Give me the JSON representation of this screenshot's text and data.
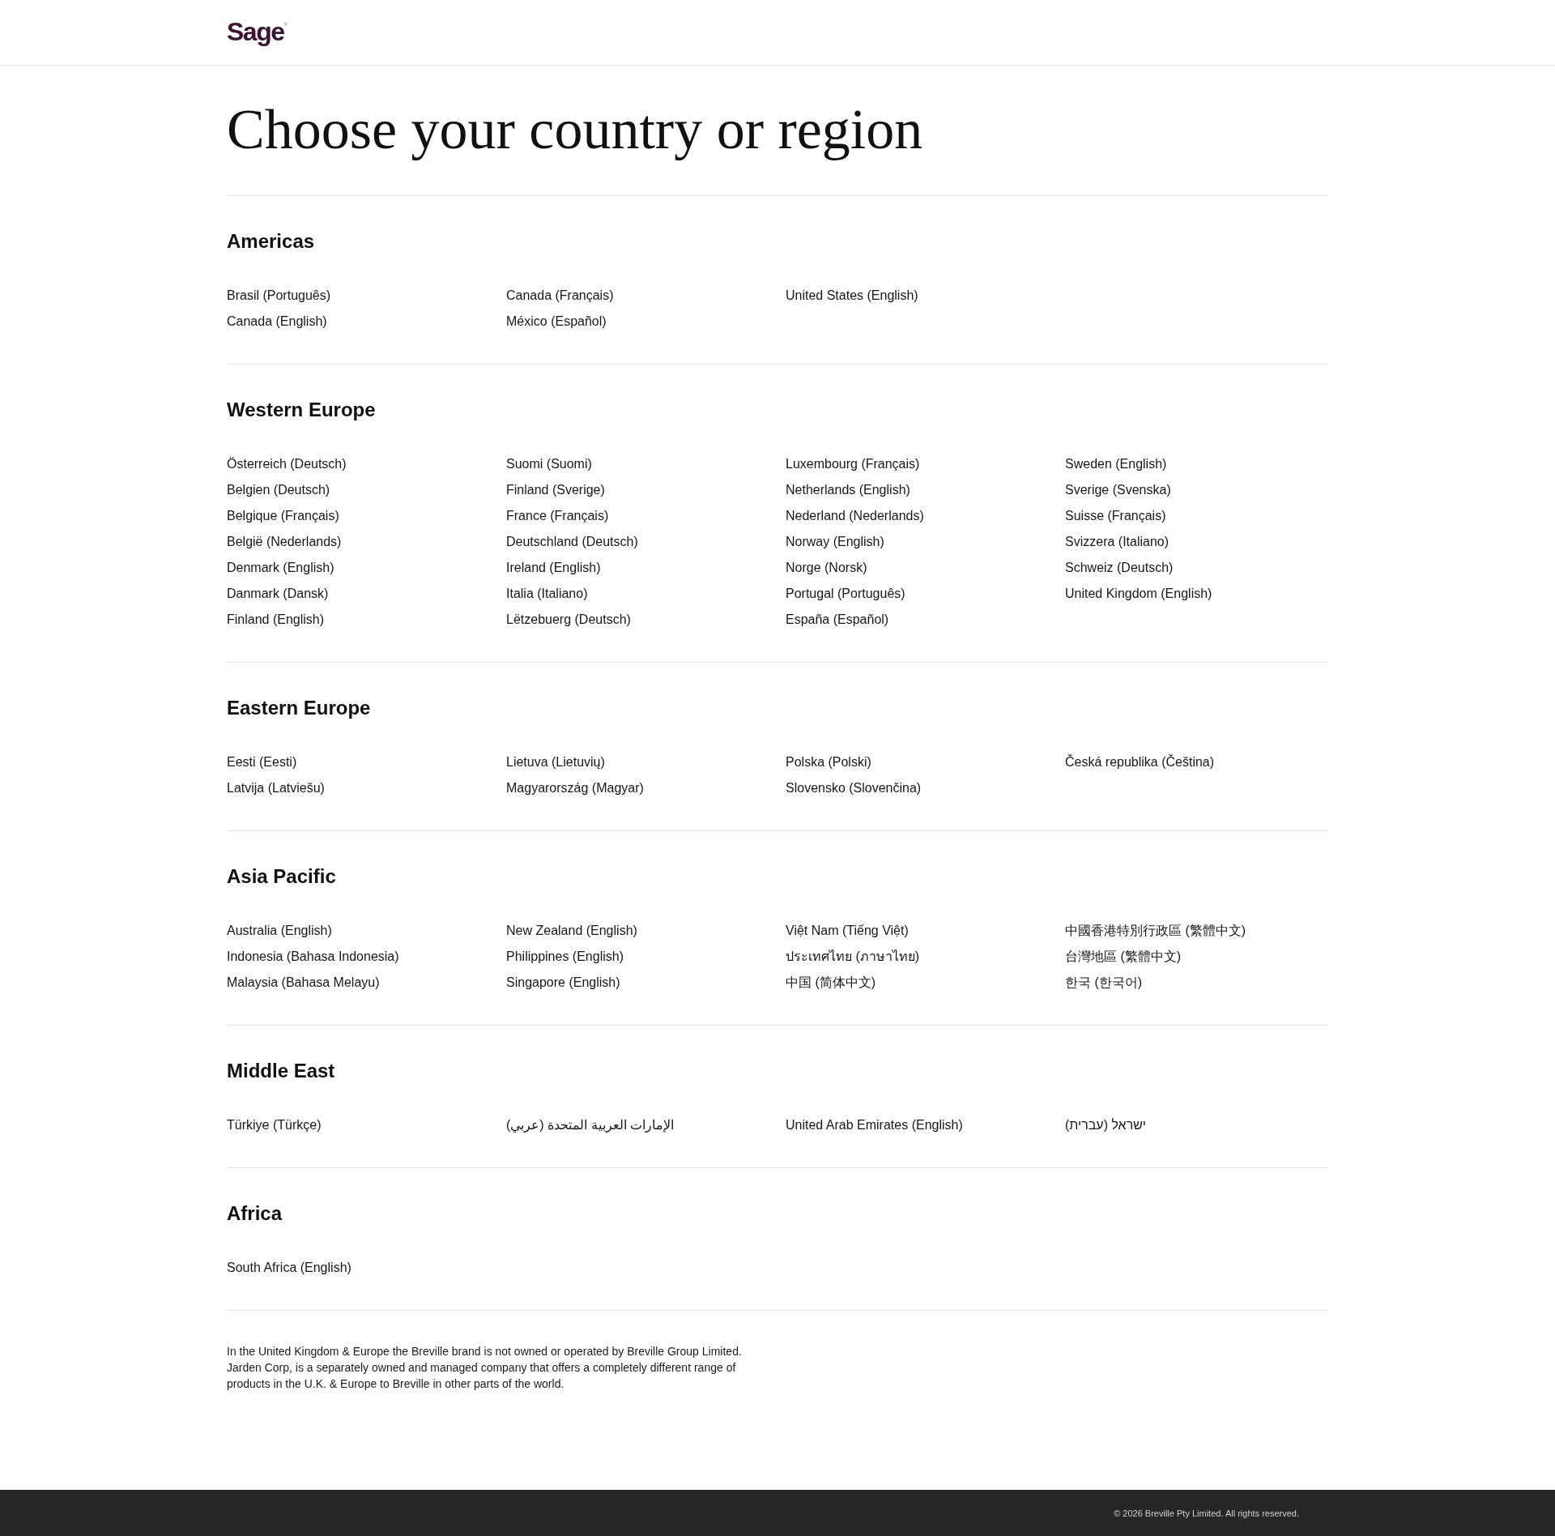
{
  "header": {
    "logo": "Sage$^{®}$"
  },
  "title": "Choose your country or region",
  "regions": [
    {
      "name": "Americas",
      "countries": [
        "Brasil (Português)",
        "Canada (English)",
        "Canada (Français)",
        "México (Español)",
        "United States (English)"
      ]
    },
    {
      "name": "Western Europe",
      "countries": [
        "Österreich (Deutsch)",
        "Belgien (Deutsch)",
        "Belgique (Français)",
        "België (Nederlands)",
        "Denmark (English)",
        "Danmark (Dansk)",
        "Finland (English)",
        "Suomi (Suomi)",
        "Finland (Sverige)",
        "France (Français)",
        "Deutschland (Deutsch)",
        "Ireland (English)",
        "Italia (Italiano)",
        "Lëtzebuerg (Deutsch)",
        "Luxembourg (Français)",
        "Netherlands (English)",
        "Nederland (Nederlands)",
        "Norway (English)",
        "Norge (Norsk)",
        "Portugal (Português)",
        "España (Español)",
        "Sweden (English)",
        "Sverige (Svenska)",
        "Suisse (Français)",
        "Svizzera (Italiano)",
        "Schweiz (Deutsch)",
        "United Kingdom (English)"
      ]
    },
    {
      "name": "Eastern Europe",
      "countries": [
        "Eesti (Eesti)",
        "Latvija (Latviešu)",
        "Lietuva (Lietuvių)",
        "Magyarország (Magyar)",
        "Polska (Polski)",
        "Slovensko (Slovenčina)",
        "Česká republika (Čeština)"
      ]
    },
    {
      "name": "Asia Pacific",
      "countries": [
        "Australia (English)",
        "Indonesia (Bahasa Indonesia)",
        "Malaysia (Bahasa Melayu)",
        "New Zealand (English)",
        "Philippines (English)",
        "Singapore (English)",
        "Việt Nam (Tiếng Việt)",
        "ประเทศไทย (ภาษาไทย)",
        "中国 (简体中文)",
        "中國香港特別行政區 (繁體中文)",
        "台灣地區 (繁體中文)",
        "한국 (한국어)"
      ]
    },
    {
      "name": "Middle East",
      "countries": [
        "Türkiye (Türkçe)",
        "الإمارات العربية المتحدة (عربي)",
        "United Arab Emirates (English)",
        "ישראל (עברית)"
      ]
    },
    {
      "name": "Africa",
      "countries": [
        "South Africa (English)"
      ]
    }
  ],
  "disclaimer": "In the United Kingdom & Europe the Breville brand is not owned or operated by Breville Group Limited. Jarden Corp, is a separately owned and managed company that offers a completely different range of products in the U.K. & Europe to Breville in other parts of the world.",
  "footer": {
    "copyright": "© 2026 Breville Pty Limited. All rights reserved."
  }
}
